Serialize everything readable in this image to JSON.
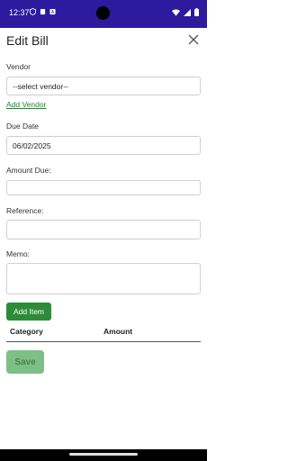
{
  "status_bar": {
    "time": "12:37",
    "icons_left": [
      "shield-icon",
      "sim-icon",
      "a-box-icon"
    ],
    "icons_right": [
      "wifi-icon",
      "signal-icon",
      "battery-icon"
    ],
    "color": "#2e1a9e"
  },
  "header": {
    "title": "Edit Bill"
  },
  "form": {
    "vendor_label": "Vendor",
    "vendor_selected": "--select vendor--",
    "add_vendor_link": "Add Vendor",
    "due_date_label": "Due Date",
    "due_date_value": "06/02/2025",
    "amount_label": "Amount Due:",
    "amount_value": "",
    "reference_label": "Reference:",
    "reference_value": "",
    "memo_label": "Memo:",
    "memo_value": ""
  },
  "items": {
    "add_button": "Add Item",
    "columns": [
      "Category",
      "Amount"
    ]
  },
  "actions": {
    "save_label": "Save"
  },
  "colors": {
    "accent_green": "#2e8b3a",
    "save_disabled_green": "#7dbf85",
    "link_green": "#1a8a2a"
  }
}
